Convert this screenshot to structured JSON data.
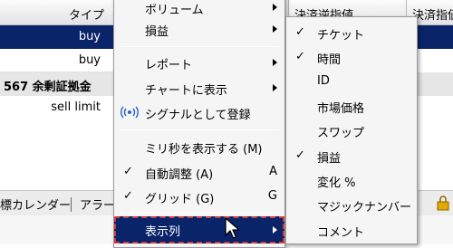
{
  "table": {
    "header_left": "タイプ",
    "header_right": [
      "決済逆指値",
      "決済指値"
    ],
    "rows": [
      "buy",
      "buy",
      "567 余剰証拠金",
      "sell limit"
    ]
  },
  "tabs": [
    "標カレンダー",
    "アラー"
  ],
  "main_menu": {
    "items": [
      {
        "label": "ボリューム",
        "arrow": true
      },
      {
        "label": "損益",
        "arrow": true
      },
      {
        "label": "レポート",
        "arrow": true
      },
      {
        "label": "チャートに表示",
        "arrow": true
      },
      {
        "label": "シグナルとして登録",
        "icon": "signal-icon"
      },
      {
        "label": "ミリ秒を表示する (M)"
      },
      {
        "label": "自動調整 (A)",
        "checked": true,
        "key": "A"
      },
      {
        "label": "グリッド (G)",
        "checked": true,
        "key": "G"
      },
      {
        "label": "表示列",
        "arrow": true,
        "selected": true
      }
    ]
  },
  "sub_menu": {
    "items": [
      {
        "label": "チケット",
        "checked": true
      },
      {
        "label": "時間",
        "checked": true
      },
      {
        "label": "ID"
      },
      {
        "label": "市場価格"
      },
      {
        "label": "スワップ"
      },
      {
        "label": "損益",
        "checked": true
      },
      {
        "label": "変化 %"
      },
      {
        "label": "マジックナンバー"
      },
      {
        "label": "コメント"
      }
    ]
  },
  "checkmark": "✓",
  "colors": {
    "selection": "#0a246a",
    "highlight_border": "#d23b3b",
    "menu_bg": "#f5f5f5"
  }
}
